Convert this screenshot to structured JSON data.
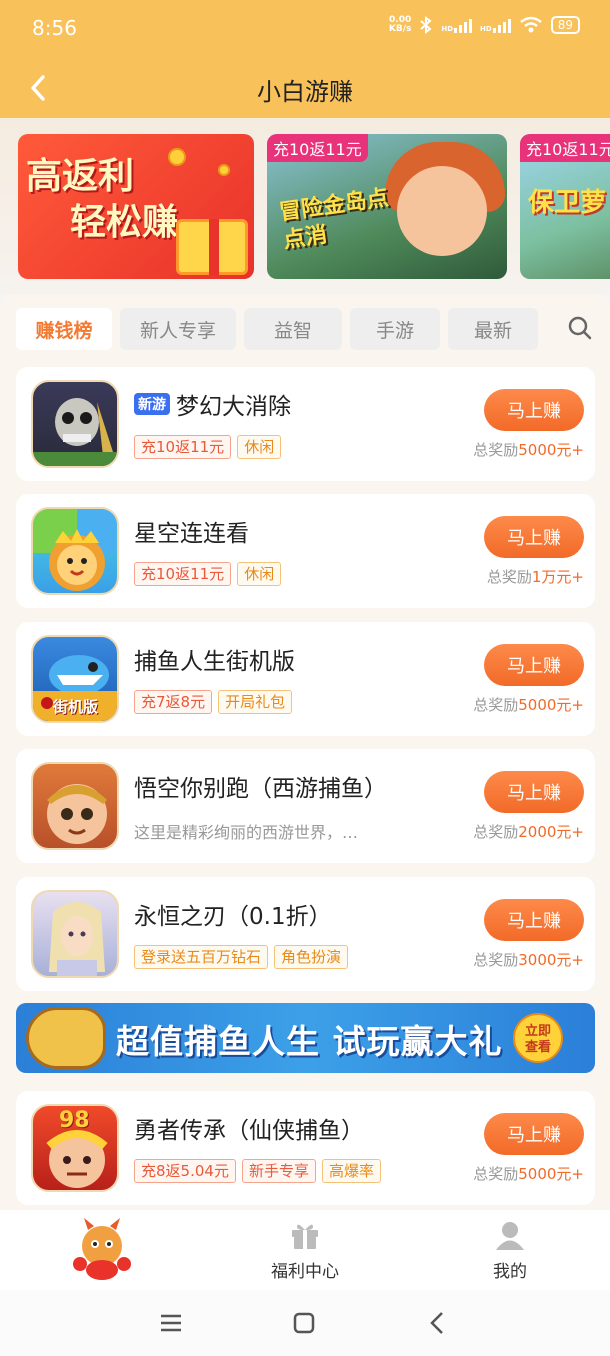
{
  "status": {
    "time": "8:56",
    "netspeed_value": "0.00",
    "netspeed_unit": "KB/s",
    "battery": "89",
    "hd1": "HD",
    "hd2": "HD"
  },
  "header": {
    "title": "小白游赚"
  },
  "banners": [
    {
      "line1": "高返利",
      "line2": "轻松赚"
    },
    {
      "tag": "充10返11元",
      "logo": "冒险金岛点点消"
    },
    {
      "tag": "充10返11元",
      "logo": "保卫萝"
    }
  ],
  "tabs": [
    "赚钱榜",
    "新人专享",
    "益智",
    "手游",
    "最新"
  ],
  "games": [
    {
      "name": "梦幻大消除",
      "badge": "新游",
      "tags": [
        {
          "text": "充10返11元",
          "color": "red"
        },
        {
          "text": "休闲",
          "color": "orange"
        }
      ],
      "button": "马上赚",
      "reward_prefix": "总奖励",
      "reward_amount": "5000元+"
    },
    {
      "name": "星空连连看",
      "tags": [
        {
          "text": "充10返11元",
          "color": "red"
        },
        {
          "text": "休闲",
          "color": "orange"
        }
      ],
      "button": "马上赚",
      "reward_prefix": "总奖励",
      "reward_amount": "1万元+"
    },
    {
      "name": "捕鱼人生街机版",
      "tags": [
        {
          "text": "充7返8元",
          "color": "red"
        },
        {
          "text": "开局礼包",
          "color": "orange"
        }
      ],
      "button": "马上赚",
      "reward_prefix": "总奖励",
      "reward_amount": "5000元+",
      "icon_label": "街机版"
    },
    {
      "name": "悟空你别跑（西游捕鱼）",
      "description": "这里是精彩绚丽的西游世界，…",
      "button": "马上赚",
      "reward_prefix": "总奖励",
      "reward_amount": "2000元+"
    },
    {
      "name": "永恒之刃（0.1折）",
      "tags": [
        {
          "text": "登录送五百万钻石",
          "color": "orange"
        },
        {
          "text": "角色扮演",
          "color": "orange"
        }
      ],
      "button": "马上赚",
      "reward_prefix": "总奖励",
      "reward_amount": "3000元+"
    },
    {
      "name": "勇者传承（仙侠捕鱼）",
      "tags": [
        {
          "text": "充8返5.04元",
          "color": "red"
        },
        {
          "text": "新手专享",
          "color": "red"
        },
        {
          "text": "高爆率",
          "color": "orange"
        }
      ],
      "button": "马上赚",
      "reward_prefix": "总奖励",
      "reward_amount": "5000元+",
      "icon_label": "98"
    }
  ],
  "ad": {
    "text": "超值捕鱼人生 试玩赢大礼",
    "cta_line1": "立即",
    "cta_line2": "查看"
  },
  "nav": {
    "welfare": "福利中心",
    "mine": "我的"
  },
  "colors": {
    "header": "#f8c15a",
    "accent": "#f26a28",
    "active_tab": "#f47a32"
  }
}
